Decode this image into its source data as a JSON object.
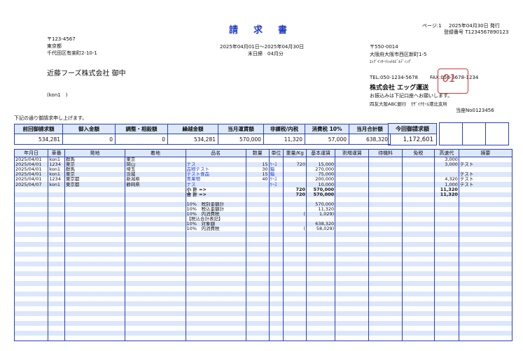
{
  "header": {
    "title": "請求書",
    "page": "ページ:1",
    "issued": "2025年04月30日 発行",
    "reg_no": "登録番号 T1234567890123",
    "period": "2025年04月01日～2025年04月30日",
    "cutoff": "末日締　04月分"
  },
  "customer": {
    "postal": "〒123-4567",
    "city": "東京都",
    "address": "千代田区有楽町2-10-1",
    "name": "近藤フーズ株式会社 御中",
    "code": "(kon1　)"
  },
  "issuer": {
    "postal": "〒550-0014",
    "address": "大阪府大阪市西区新町1-5",
    "building": "ｴｯｸﾞｲﾝﾀｰﾅｼｮﾅﾙﾋﾞﾙﾃﾞｨﾝｸﾞ",
    "tel": "TEL:050-1234-5678",
    "fax": "FAX:050-5678-1234",
    "company": "株式会社 エッグ運送",
    "transfer_note": "お振込みは下記口座へお願いします。",
    "bank": "四友大阪ABC銀行　ﾓｻﾞｲｸﾓｰﾙ港北支所",
    "account": "当座No0123456",
    "stamp_text": "01"
  },
  "intro": "下記の通り御請求申し上げます。",
  "summary": {
    "headers": [
      "前回御請求額",
      "御入金額",
      "調整・相殺額",
      "繰越金額",
      "当月運賃額",
      "非課税/内税",
      "消費税 10%",
      "当月合計額"
    ],
    "values": [
      "534,281",
      "0",
      "0",
      "534,281",
      "570,000",
      "11,320",
      "57,000",
      "638,320"
    ]
  },
  "current": {
    "label": "今回御請求額",
    "value": "1,172,601"
  },
  "detail": {
    "headers": [
      "年月日",
      "車番",
      "発地",
      "着地",
      "品名",
      "数量",
      "単位",
      "重量/Kg",
      "基本運賃",
      "割増運賃",
      "待機料",
      "免税",
      "高速代",
      "摘要"
    ],
    "rows": [
      [
        "2025/04/01",
        "kon1",
        "群馬",
        "東京",
        "",
        "",
        "",
        "",
        "",
        "",
        "",
        "",
        "3,000",
        ""
      ],
      [
        "2025/04/01",
        "1234",
        "東京",
        "岡山",
        "ナス",
        "15",
        "ｹｰｽ",
        "720",
        "15,000",
        "",
        "",
        "",
        "3,000",
        "テスト"
      ],
      [
        "2025/04/01",
        "kon1",
        "群馬",
        "埼玉",
        "品物テスト",
        "30",
        "箱",
        "",
        "270,000",
        "",
        "",
        "",
        "",
        ""
      ],
      [
        "2025/04/01",
        "kon1",
        "東京",
        "茨城",
        "テスト食品",
        "15",
        "箱",
        "",
        "75,000",
        "",
        "",
        "",
        "",
        "テスト"
      ],
      [
        "2025/04/01",
        "1234",
        "東京都",
        "新潟県",
        "青果物",
        "40",
        "ｹｰｽ",
        "",
        "200,000",
        "",
        "",
        "",
        "4,320",
        "テスト"
      ],
      [
        "2025/04/07",
        "kon1",
        "東京都",
        "静岡県",
        "ナス",
        "",
        "ｹｰｽ",
        "",
        "10,000",
        "",
        "",
        "",
        "1,000",
        "テスト"
      ],
      [
        "",
        "",
        "",
        "",
        "小 計 =>",
        "",
        "",
        "720",
        "570,000",
        "",
        "",
        "",
        "11,320",
        ""
      ],
      [
        "",
        "",
        "",
        "",
        "合 計 =>",
        "",
        "",
        "720",
        "570,000",
        "",
        "",
        "",
        "11,320",
        ""
      ],
      [
        "",
        "",
        "",
        "",
        "",
        "",
        "",
        "",
        "",
        "",
        "",
        "",
        "",
        ""
      ],
      [
        "",
        "",
        "",
        "",
        "10%　税別金額計",
        "",
        "",
        "",
        "570,000",
        "",
        "",
        "",
        "",
        ""
      ],
      [
        "",
        "",
        "",
        "",
        "10%　税込金額計",
        "",
        "",
        "",
        "11,320",
        "",
        "",
        "",
        "",
        ""
      ],
      [
        "",
        "",
        "",
        "",
        "10%　内消費税",
        "",
        "",
        "(",
        "1,029)",
        "",
        "",
        "",
        "",
        ""
      ],
      [
        "",
        "",
        "",
        "",
        "【税込合計表記】",
        "",
        "",
        "",
        "",
        "",
        "",
        "",
        "",
        ""
      ],
      [
        "",
        "",
        "",
        "",
        "10%　対象額",
        "",
        "",
        "",
        "638,320",
        "",
        "",
        "",
        "",
        ""
      ],
      [
        "",
        "",
        "",
        "",
        "10%　内消費税",
        "",
        "",
        "(",
        "58,029)",
        "",
        "",
        "",
        "",
        ""
      ]
    ],
    "blank_rows": 22
  }
}
